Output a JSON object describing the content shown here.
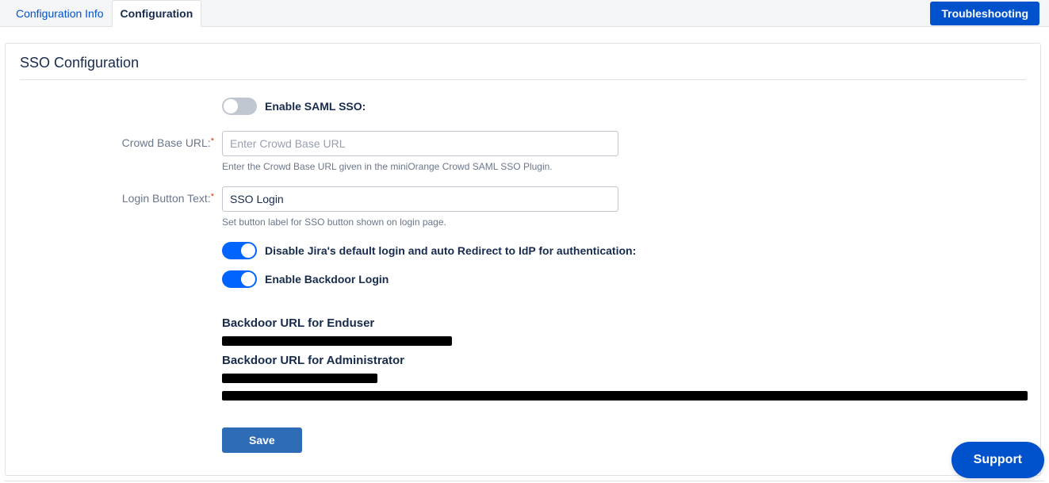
{
  "tabs": {
    "info": "Configuration Info",
    "config": "Configuration",
    "troubleshoot": "Troubleshooting"
  },
  "panel": {
    "title": "SSO Configuration"
  },
  "form": {
    "enable_saml_label": "Enable SAML SSO:",
    "enable_saml_on": false,
    "crowd_url_label": "Crowd Base URL:",
    "crowd_url_value": "",
    "crowd_url_placeholder": "Enter Crowd Base URL",
    "crowd_url_hint": "Enter the Crowd Base URL given in the miniOrange Crowd SAML SSO Plugin.",
    "login_btn_label": "Login Button Text:",
    "login_btn_value": "SSO Login",
    "login_btn_hint": "Set button label for SSO button shown on login page.",
    "disable_default_label": "Disable Jira's default login and auto Redirect to IdP for authentication:",
    "disable_default_on": true,
    "backdoor_toggle_label": "Enable Backdoor Login",
    "backdoor_toggle_on": true,
    "backdoor_enduser_heading": "Backdoor URL for Enduser",
    "backdoor_admin_heading": "Backdoor URL for Administrator",
    "save_label": "Save"
  },
  "support": {
    "label": "Support"
  }
}
